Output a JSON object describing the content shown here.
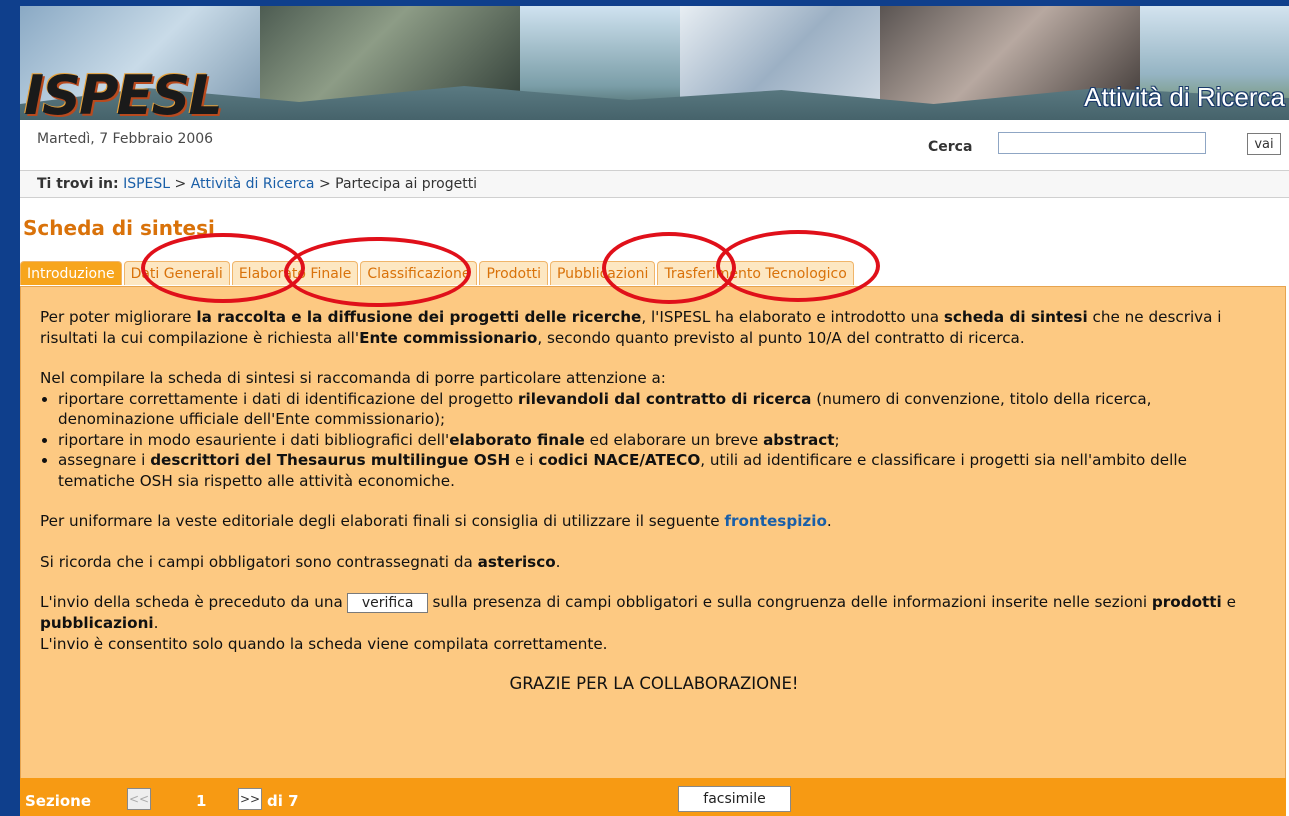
{
  "banner": {
    "logo": "ISPESL",
    "title": "Attività di Ricerca"
  },
  "date": "Martedì, 7 Febbraio 2006",
  "search": {
    "label": "Cerca",
    "value": "",
    "button": "vai"
  },
  "breadcrumb": {
    "prefix": "Ti trovi in:",
    "items": [
      "ISPESL",
      "Attività di Ricerca",
      "Partecipa ai progetti"
    ],
    "separator": ">"
  },
  "page_title": "Scheda di sintesi",
  "tabs": [
    {
      "label": "Introduzione",
      "active": true
    },
    {
      "label": "Dati Generali",
      "active": false
    },
    {
      "label": "Elaborato Finale",
      "active": false
    },
    {
      "label": "Classificazione",
      "active": false
    },
    {
      "label": "Prodotti",
      "active": false
    },
    {
      "label": "Pubblicazioni",
      "active": false
    },
    {
      "label": "Trasferimento Tecnologico",
      "active": false
    }
  ],
  "content": {
    "p1": {
      "a": "Per poter migliorare ",
      "b": "la raccolta e la diffusione dei progetti delle ricerche",
      "c": ", l'ISPESL ha elaborato e introdotto una ",
      "d": "scheda di sintesi",
      "e": " che ne descriva i risultati la cui compilazione è richiesta all'",
      "f": "Ente commissionario",
      "g": ", secondo quanto previsto al punto 10/A del contratto di ricerca."
    },
    "p2_intro": "Nel compilare la scheda di sintesi si raccomanda di porre particolare attenzione a:",
    "bullet1": {
      "a": "riportare correttamente i dati di identificazione del progetto ",
      "b": "rilevandoli dal contratto di ricerca",
      "c": " (numero di convenzione, titolo della ricerca, denominazione ufficiale dell'Ente commissionario);"
    },
    "bullet2": {
      "a": "riportare in modo esauriente i dati bibliografici dell'",
      "b": "elaborato finale",
      "c": " ed elaborare un breve ",
      "d": "abstract",
      "e": ";"
    },
    "bullet3": {
      "a": "assegnare i ",
      "b": "descrittori del Thesaurus multilingue OSH",
      "c": " e i ",
      "d": "codici NACE/ATECO",
      "e": ", utili ad identificare e classificare i progetti sia nell'ambito delle tematiche OSH sia rispetto alle attività economiche."
    },
    "p3": {
      "a": "Per uniformare la veste editoriale degli elaborati finali si consiglia di utilizzare il seguente ",
      "link": "frontespizio",
      "b": "."
    },
    "p4": {
      "a": "Si ricorda che i campi obbligatori sono contrassegnati da ",
      "b": "asterisco",
      "c": "."
    },
    "p5": {
      "a": "L'invio della scheda è preceduto da una",
      "button": "verifica",
      "b": "sulla presenza di campi obbligatori e sulla congruenza delle informazioni inserite nelle sezioni ",
      "c": "prodotti",
      "d": " e ",
      "e": "pubblicazioni",
      "f": ".",
      "g": "L'invio è consentito solo quando la scheda viene compilata correttamente."
    },
    "thanks": "GRAZIE PER LA COLLABORAZIONE!"
  },
  "footer": {
    "section_label": "Sezione",
    "prev": "<<",
    "page": "1",
    "next": ">>",
    "total": "di 7",
    "facsimile": "facsimile"
  },
  "colors": {
    "frame": "#0f3f8c",
    "accent": "#d9720a",
    "content_bg": "#fdc982",
    "bar": "#f79a13",
    "highlight_ring": "#e0101a"
  }
}
